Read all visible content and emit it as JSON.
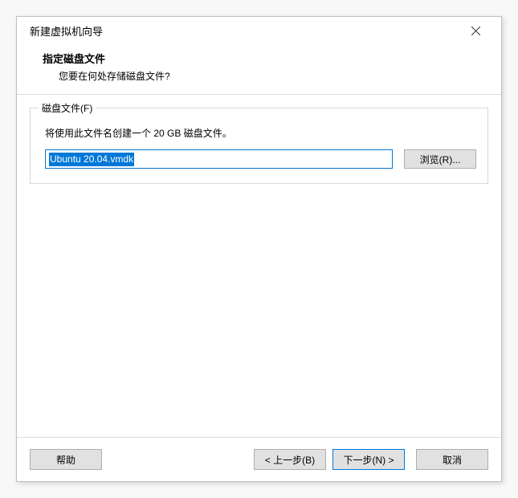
{
  "window": {
    "title": "新建虚拟机向导"
  },
  "header": {
    "heading": "指定磁盘文件",
    "subheading": "您要在何处存储磁盘文件?"
  },
  "group": {
    "label": "磁盘文件(F)",
    "description": "将使用此文件名创建一个 20 GB 磁盘文件。",
    "filename": "Ubuntu 20.04.vmdk",
    "browse_label": "浏览(R)..."
  },
  "footer": {
    "help": "帮助",
    "back": "< 上一步(B)",
    "next": "下一步(N) >",
    "cancel": "取消"
  }
}
